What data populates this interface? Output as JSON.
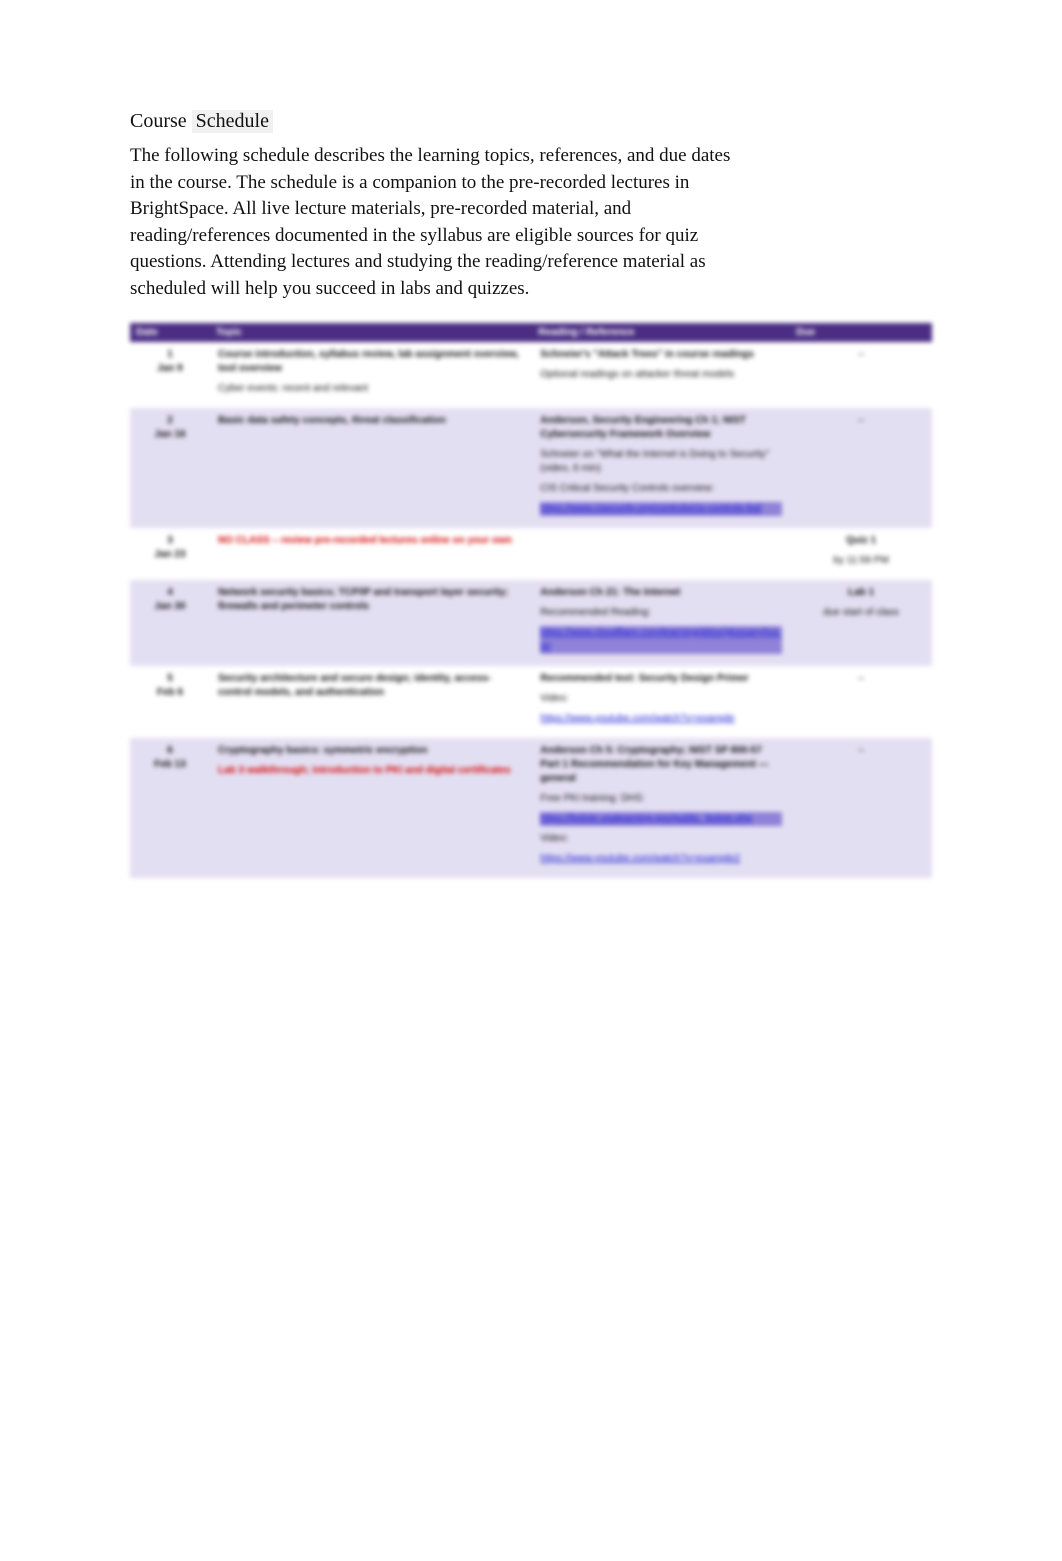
{
  "heading": {
    "word1": "Course",
    "word2": "Schedule"
  },
  "intro": "The following schedule describes the learning topics, references, and due dates in the course. The schedule is a companion to the pre-recorded lectures in BrightSpace. All live lecture materials, pre-recorded material, and reading/references documented in the syllabus are eligible sources for quiz questions. Attending lectures and studying the reading/reference material as scheduled will help you succeed in labs and quizzes.",
  "columns": {
    "date": "Date",
    "topic": "Topic",
    "ref": "Reading / Reference",
    "due": "Due"
  },
  "rows": [
    {
      "shade": "white",
      "date": "1\nJan 9",
      "topic": [
        {
          "text": "Course introduction, syllabus review, lab assignment overview, tool overview",
          "cls": "b"
        },
        {
          "text": "Cyber events: recent and relevant",
          "cls": ""
        }
      ],
      "ref": [
        {
          "text": "Schneier's \"Attack Trees\" in course readings",
          "cls": "b"
        },
        {
          "text": "Optional readings on attacker threat models",
          "cls": ""
        }
      ],
      "due": [
        {
          "text": "–",
          "cls": ""
        }
      ]
    },
    {
      "shade": "shade",
      "date": "2\nJan 16",
      "topic": [
        {
          "text": "Basic data safety concepts, threat classification",
          "cls": "b"
        }
      ],
      "ref": [
        {
          "text": "Anderson, Security Engineering Ch 1; NIST Cybersecurity Framework Overview",
          "cls": "b"
        },
        {
          "text": "Schneier on \"What the Internet is Doing to Security\" (video, 6 min)",
          "cls": ""
        },
        {
          "text": "CIS Critical Security Controls overview:",
          "cls": ""
        },
        {
          "text": "https://www.cisecurity.org/controls/cis-controls-list/",
          "cls": "hl"
        }
      ],
      "due": [
        {
          "text": "–",
          "cls": ""
        }
      ]
    },
    {
      "shade": "white",
      "date": "3\nJan 23",
      "topic": [
        {
          "text": "NO CLASS – review pre-recorded lectures online on your own",
          "cls": "redtext"
        }
      ],
      "ref": [],
      "due": [
        {
          "text": "Quiz 1",
          "cls": "b"
        },
        {
          "text": "by 11:59 PM",
          "cls": ""
        }
      ]
    },
    {
      "shade": "shade",
      "date": "4\nJan 30",
      "topic": [
        {
          "text": "Network security basics; TCP/IP and transport layer security; firewalls and perimeter controls",
          "cls": "b"
        }
      ],
      "ref": [
        {
          "text": "Anderson Ch 21: The Internet",
          "cls": "b"
        },
        {
          "text": "Recommended Reading:",
          "cls": ""
        },
        {
          "text": "https://www.cloudflare.com/learning/ddos/glossary/tcp-ip/",
          "cls": "hl"
        }
      ],
      "due": [
        {
          "text": "Lab 1",
          "cls": "b"
        },
        {
          "text": "due start of class",
          "cls": ""
        }
      ]
    },
    {
      "shade": "white",
      "date": "5\nFeb 6",
      "topic": [
        {
          "text": "Security architecture and secure design; identity, access-control models, and authentication",
          "cls": "b"
        }
      ],
      "ref": [
        {
          "text": "Recommended text: Security Design Primer",
          "cls": "b"
        },
        {
          "text": "Video: ",
          "cls": ""
        },
        {
          "text": "https://www.youtube.com/watch?v=example",
          "cls": "link"
        }
      ],
      "due": [
        {
          "text": "–",
          "cls": ""
        }
      ]
    },
    {
      "shade": "shade",
      "date": "6\nFeb 13",
      "topic": [
        {
          "text": "Cryptography basics: symmetric encryption",
          "cls": "b"
        },
        {
          "text": "Lab 3 walkthrough; introduction to PKI and digital certificates",
          "cls": "redtext"
        }
      ],
      "ref": [
        {
          "text": "Anderson Ch 5: Cryptography; NIST SP 800-57 Part 1 Recommendation for Key Management — general",
          "cls": "b"
        },
        {
          "text": "Free PKI training: DHS:",
          "cls": ""
        },
        {
          "text": "https://fedvte.usalearning.gov/public_fedvte.php",
          "cls": "hl"
        },
        {
          "text": "Video: ",
          "cls": ""
        },
        {
          "text": "https://www.youtube.com/watch?v=example2",
          "cls": "link"
        }
      ],
      "due": [
        {
          "text": "–",
          "cls": ""
        }
      ]
    },
    {
      "shade": "white",
      "date": " ",
      "topic": [],
      "ref": [],
      "due": []
    }
  ]
}
